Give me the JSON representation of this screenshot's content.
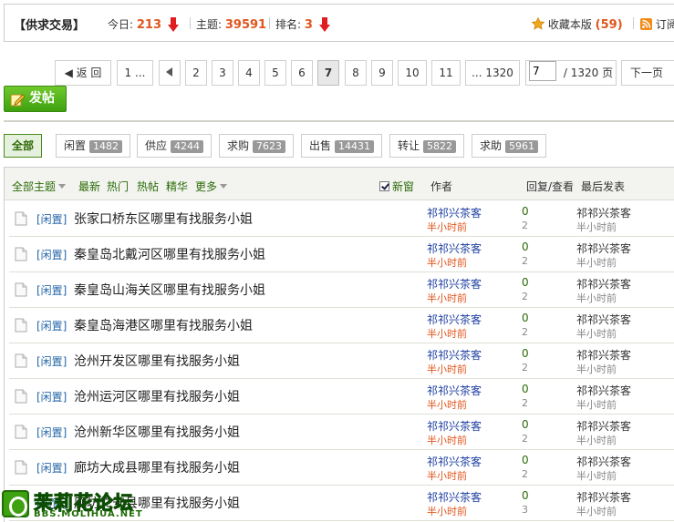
{
  "header": {
    "title": "【供求交易】",
    "today_label": "今日:",
    "today_value": "213",
    "topics_label": "主题:",
    "topics_value": "39591",
    "rank_label": "排名:",
    "rank_value": "3",
    "fav_label": "收藏本版",
    "fav_count": "(59)",
    "rss_label": "订阅"
  },
  "pager": {
    "back": "◀ 返 回",
    "first": "1 ...",
    "prev_icon": "◀",
    "pages": [
      "2",
      "3",
      "4",
      "5",
      "6",
      "7",
      "8",
      "9",
      "10",
      "11"
    ],
    "current": "7",
    "last": "... 1320",
    "input_value": "7",
    "total": "/ 1320 页",
    "next": "下一页"
  },
  "post_button": "发帖",
  "filters": [
    {
      "label": "全部",
      "count": ""
    },
    {
      "label": "闲置",
      "count": "1482"
    },
    {
      "label": "供应",
      "count": "4244"
    },
    {
      "label": "求购",
      "count": "7623"
    },
    {
      "label": "出售",
      "count": "14431"
    },
    {
      "label": "转让",
      "count": "5822"
    },
    {
      "label": "求助",
      "count": "5961"
    }
  ],
  "table_header": {
    "all_topics": "全部主题",
    "latest": "最新",
    "hot": "热门",
    "hot_posts": "热帖",
    "digest": "精华",
    "more": "更多",
    "new_window": "新窗",
    "author": "作者",
    "reply_view": "回复/查看",
    "last_post": "最后发表"
  },
  "rows": [
    {
      "cat": "[闲置]",
      "subject": "张家口桥东区哪里有找服务小姐",
      "author": "祁祁兴茶客",
      "time": "半小时前",
      "replies": "0",
      "views": "2",
      "last_user": "祁祁兴茶客",
      "last_time": "半小时前"
    },
    {
      "cat": "[闲置]",
      "subject": "秦皇岛北戴河区哪里有找服务小姐",
      "author": "祁祁兴茶客",
      "time": "半小时前",
      "replies": "0",
      "views": "2",
      "last_user": "祁祁兴茶客",
      "last_time": "半小时前"
    },
    {
      "cat": "[闲置]",
      "subject": "秦皇岛山海关区哪里有找服务小姐",
      "author": "祁祁兴茶客",
      "time": "半小时前",
      "replies": "0",
      "views": "2",
      "last_user": "祁祁兴茶客",
      "last_time": "半小时前"
    },
    {
      "cat": "[闲置]",
      "subject": "秦皇岛海港区哪里有找服务小姐",
      "author": "祁祁兴茶客",
      "time": "半小时前",
      "replies": "0",
      "views": "2",
      "last_user": "祁祁兴茶客",
      "last_time": "半小时前"
    },
    {
      "cat": "[闲置]",
      "subject": "沧州开发区哪里有找服务小姐",
      "author": "祁祁兴茶客",
      "time": "半小时前",
      "replies": "0",
      "views": "2",
      "last_user": "祁祁兴茶客",
      "last_time": "半小时前"
    },
    {
      "cat": "[闲置]",
      "subject": "沧州运河区哪里有找服务小姐",
      "author": "祁祁兴茶客",
      "time": "半小时前",
      "replies": "0",
      "views": "2",
      "last_user": "祁祁兴茶客",
      "last_time": "半小时前"
    },
    {
      "cat": "[闲置]",
      "subject": "沧州新华区哪里有找服务小姐",
      "author": "祁祁兴茶客",
      "time": "半小时前",
      "replies": "0",
      "views": "2",
      "last_user": "祁祁兴茶客",
      "last_time": "半小时前"
    },
    {
      "cat": "[闲置]",
      "subject": "廊坊大成县哪里有找服务小姐",
      "author": "祁祁兴茶客",
      "time": "半小时前",
      "replies": "0",
      "views": "2",
      "last_user": "祁祁兴茶客",
      "last_time": "半小时前"
    },
    {
      "cat": "[闲置]",
      "subject": "廊坊文安县哪里有找服务小姐",
      "author": "祁祁兴茶客",
      "time": "半小时前",
      "replies": "0",
      "views": "3",
      "last_user": "祁祁兴茶客",
      "last_time": "半小时前"
    }
  ],
  "watermark": {
    "name": "茉莉花论坛",
    "url": "BBS.MOLIHUA.NET"
  },
  "colors": {
    "accent_green": "#3ea10f",
    "count_orange": "#e0561e",
    "link_blue": "#2366a8"
  }
}
